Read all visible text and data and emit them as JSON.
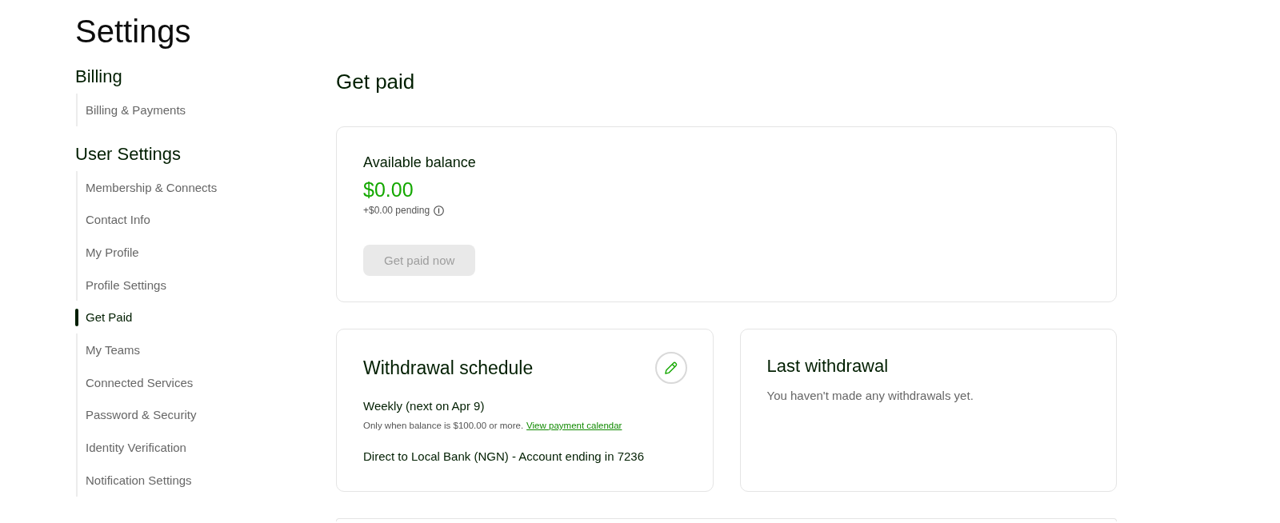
{
  "page": {
    "title": "Settings"
  },
  "sidebar": {
    "sections": [
      {
        "heading": "Billing",
        "items": [
          {
            "label": "Billing & Payments",
            "selected": false
          }
        ]
      },
      {
        "heading": "User Settings",
        "items": [
          {
            "label": "Membership & Connects",
            "selected": false
          },
          {
            "label": "Contact Info",
            "selected": false
          },
          {
            "label": "My Profile",
            "selected": false
          },
          {
            "label": "Profile Settings",
            "selected": false
          },
          {
            "label": "Get Paid",
            "selected": true
          },
          {
            "label": "My Teams",
            "selected": false
          },
          {
            "label": "Connected Services",
            "selected": false
          },
          {
            "label": "Password & Security",
            "selected": false
          },
          {
            "label": "Identity Verification",
            "selected": false
          },
          {
            "label": "Notification Settings",
            "selected": false
          }
        ]
      }
    ]
  },
  "main": {
    "title": "Get paid",
    "balance_card": {
      "title": "Available balance",
      "amount": "$0.00",
      "pending": "+$0.00 pending",
      "button": {
        "label": "Get paid now",
        "disabled": true
      }
    },
    "schedule_card": {
      "title": "Withdrawal schedule",
      "frequency": "Weekly (next on Apr 9)",
      "condition": "Only when balance is $100.00 or more.",
      "link": "View payment calendar",
      "method": "Direct to Local Bank (NGN) - Account ending in 7236"
    },
    "last_withdrawal_card": {
      "title": "Last withdrawal",
      "message": "You haven't made any withdrawals yet."
    }
  }
}
